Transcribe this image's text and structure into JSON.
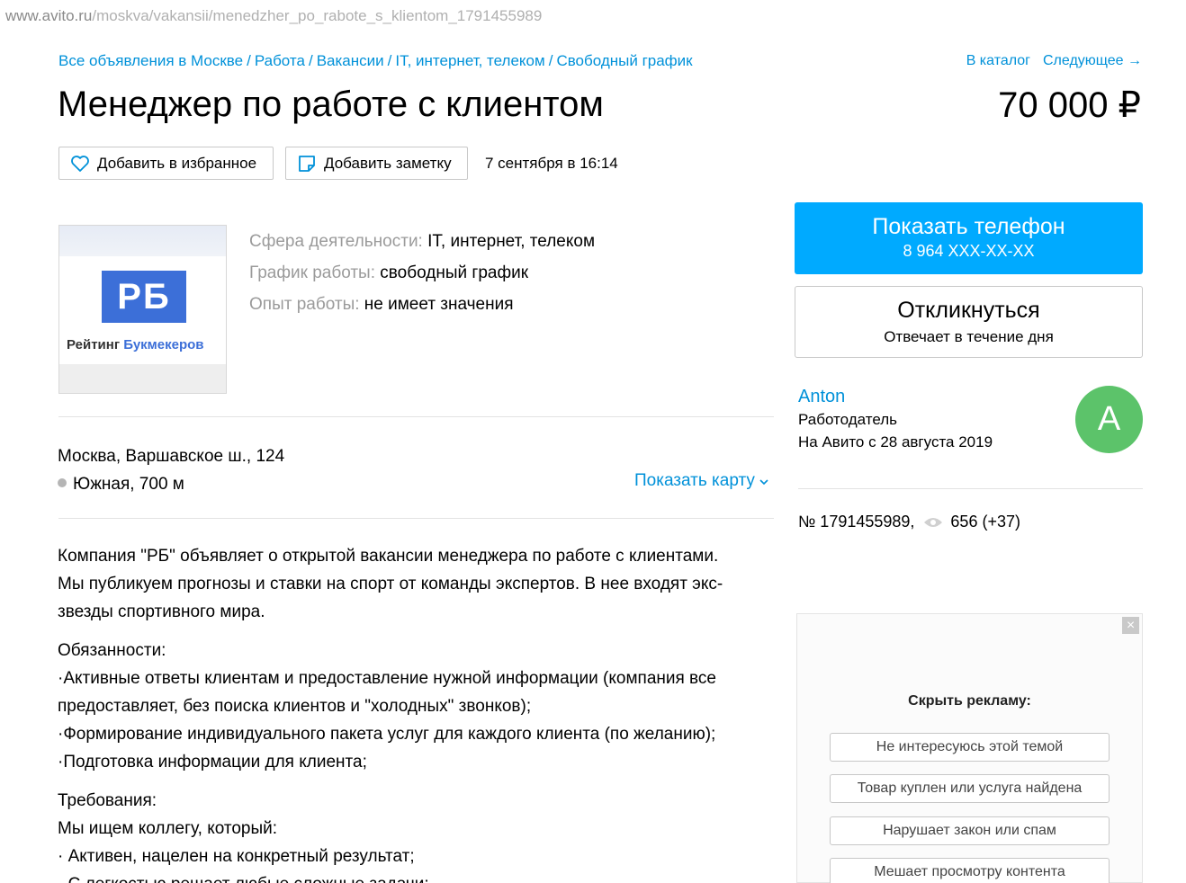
{
  "url": {
    "host": "www.avito.ru",
    "path": "/moskva/vakansii/menedzher_po_rabote_s_klientom_1791455989"
  },
  "breadcrumbs": [
    "Все объявления в Москве",
    "Работа",
    "Вакансии",
    "IT, интернет, телеком",
    "Свободный график"
  ],
  "breadcrumb_sep": "/",
  "topnav": {
    "catalog": "В каталог",
    "next": "Следующее →"
  },
  "title": "Менеджер по работе с клиентом",
  "price": "70 000 ₽",
  "actions": {
    "favorite": "Добавить в избранное",
    "note": "Добавить заметку",
    "date": "7 сентября в 16:14"
  },
  "logo": {
    "mark": "РБ",
    "text_a": "Рейтинг ",
    "text_b": "Букмекеров"
  },
  "params": [
    {
      "key": "Сфера деятельности:",
      "value": "IT, интернет, телеком"
    },
    {
      "key": "График работы:",
      "value": "свободный график"
    },
    {
      "key": "Опыт работы:",
      "value": "не имеет значения"
    }
  ],
  "address": {
    "street": "Москва, Варшавское ш., 124",
    "metro": "Южная, 700 м",
    "show_map": "Показать карту"
  },
  "description": {
    "p1": [
      "Компания \"РБ\" объявляет о открытой вакансии менеджера по работе с клиентами.",
      "Мы публикуем прогнозы и ставки на спорт от команды экспертов. В нее входят экс-",
      "звезды спортивного мира."
    ],
    "p2": [
      "Обязанности:",
      "·Активные ответы клиентам и предоставление нужной информации (компания все",
      "предоставляет, без поиска клиентов и \"холодных\" звонков);",
      "·Формирование индивидуального пакета услуг для каждого клиента (по желанию);",
      "·Подготовка информации для клиента;"
    ],
    "p3": [
      "Требования:",
      "Мы ищем коллегу, который:",
      "· Активен, нацелен на конкретный результат;",
      "· С легкостью решает любые сложные задачи;"
    ]
  },
  "phone": {
    "label": "Показать телефон",
    "number": "8 964 XXX-XX-XX"
  },
  "reply": {
    "label": "Откликнуться",
    "sub": "Отвечает в течение дня"
  },
  "seller": {
    "name": "Anton",
    "role": "Работодатель",
    "since": "На Авито с 28 августа 2019",
    "avatar_letter": "A",
    "avatar_color": "#5cc36a"
  },
  "item": {
    "number": "№ 1791455989,",
    "views": "656 (+37)"
  },
  "ad": {
    "close": "×",
    "title": "Скрыть рекламу:",
    "options": [
      "Не интересуюсь этой темой",
      "Товар куплен или услуга найдена",
      "Нарушает закон или спам",
      "Мешает просмотру контента"
    ]
  },
  "colors": {
    "link": "#0091d9",
    "primary": "#00aaff",
    "muted": "#9b9b9b"
  }
}
